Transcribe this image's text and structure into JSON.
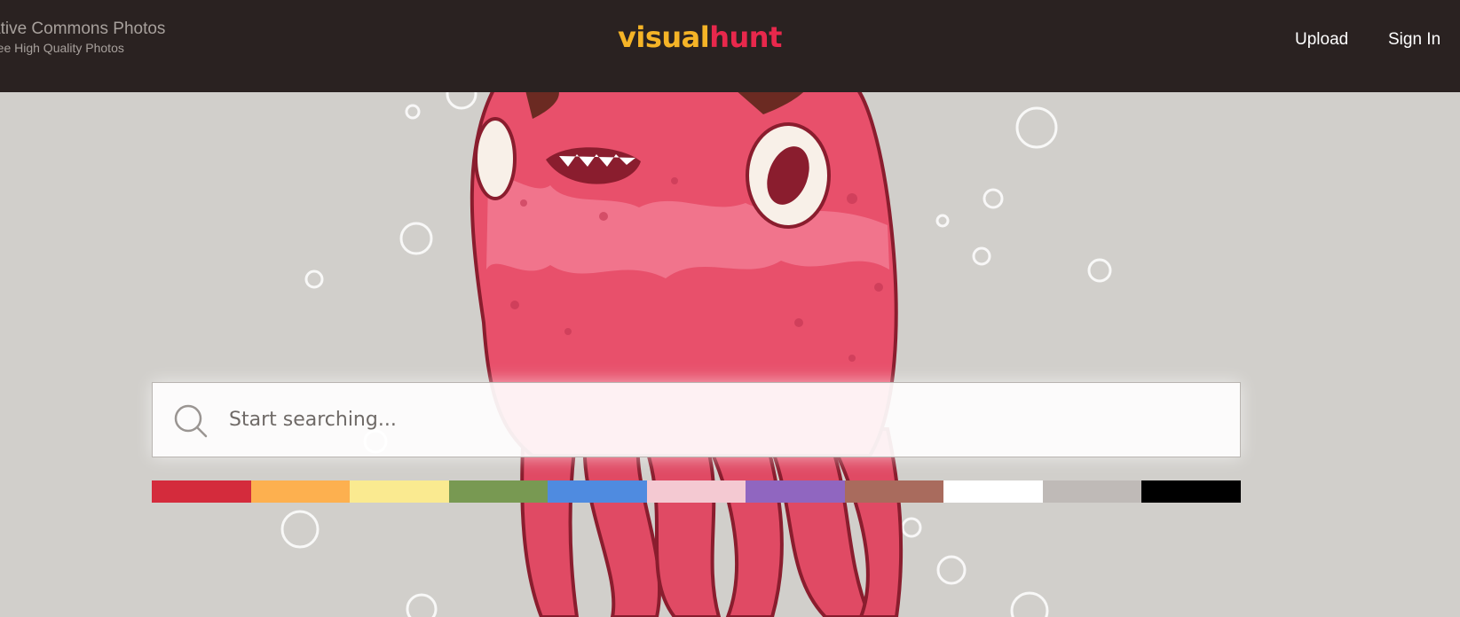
{
  "header": {
    "tagline": "ative Commons Photos",
    "subtagline": "ree High Quality Photos",
    "logo": {
      "part1": "visual",
      "part2": "hunt"
    },
    "nav": {
      "upload": "Upload",
      "signin": "Sign In"
    }
  },
  "search": {
    "placeholder": "Start searching..."
  },
  "colors": [
    {
      "name": "red",
      "hex": "#d42b3c"
    },
    {
      "name": "orange",
      "hex": "#fdb04f"
    },
    {
      "name": "yellow",
      "hex": "#faea90"
    },
    {
      "name": "green",
      "hex": "#789952"
    },
    {
      "name": "blue",
      "hex": "#4f8be0"
    },
    {
      "name": "pink",
      "hex": "#f4c9d2"
    },
    {
      "name": "purple",
      "hex": "#9066c0"
    },
    {
      "name": "brown",
      "hex": "#a96b5d"
    },
    {
      "name": "white",
      "hex": "#ffffff"
    },
    {
      "name": "gray",
      "hex": "#bfbab7"
    },
    {
      "name": "black",
      "hex": "#000000"
    }
  ],
  "theme": {
    "header_bg": "#2a2221",
    "hero_bg": "#d1cfcb",
    "logo_yellow": "#f5b427",
    "logo_red": "#e8284c"
  }
}
